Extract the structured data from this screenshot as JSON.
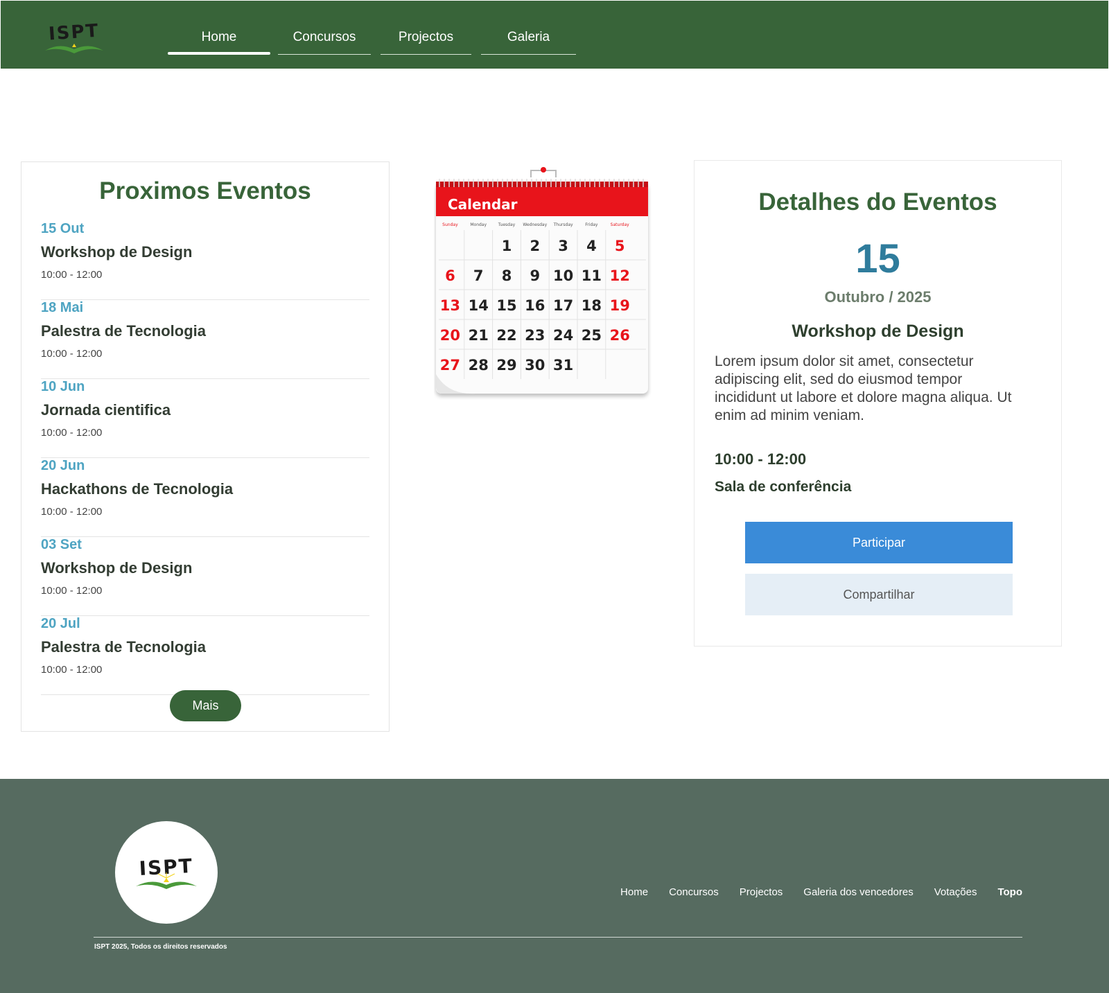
{
  "header": {
    "logo_text": "ISPT",
    "nav": [
      {
        "label": "Home",
        "active": true
      },
      {
        "label": "Concursos",
        "active": false
      },
      {
        "label": "Projectos",
        "active": false
      },
      {
        "label": "Galeria",
        "active": false
      }
    ]
  },
  "events": {
    "title": "Proximos Eventos",
    "items": [
      {
        "date": "15 Out",
        "title": "Workshop de Design",
        "time": "10:00 - 12:00"
      },
      {
        "date": "18 Mai",
        "title": "Palestra de Tecnologia",
        "time": "10:00 - 12:00"
      },
      {
        "date": "10 Jun",
        "title": "Jornada cientifica",
        "time": "10:00 - 12:00"
      },
      {
        "date": "20 Jun",
        "title": "Hackathons de Tecnologia",
        "time": "10:00 - 12:00"
      },
      {
        "date": "03 Set",
        "title": "Workshop de Design",
        "time": "10:00 - 12:00"
      },
      {
        "date": "20 Jul",
        "title": "Palestra de Tecnologia",
        "time": "10:00 - 12:00"
      }
    ],
    "more_label": "Mais"
  },
  "calendar_image": {
    "header": "Calendar",
    "weekdays": [
      "Sunday",
      "Monday",
      "Tuesday",
      "Wednesday",
      "Thursday",
      "Friday",
      "Saturday"
    ],
    "weeks": [
      [
        "",
        "",
        "1",
        "2",
        "3",
        "4",
        "5"
      ],
      [
        "6",
        "7",
        "8",
        "9",
        "10",
        "11",
        "12"
      ],
      [
        "13",
        "14",
        "15",
        "16",
        "17",
        "18",
        "19"
      ],
      [
        "20",
        "21",
        "22",
        "23",
        "24",
        "25",
        "26"
      ],
      [
        "27",
        "28",
        "29",
        "30",
        "31",
        "",
        ""
      ]
    ],
    "accent": "#e8141b"
  },
  "details": {
    "title": "Detalhes do Eventos",
    "day": "15",
    "month_year": "Outubro / 2025",
    "event_title": "Workshop de Design",
    "description": "Lorem ipsum dolor sit amet, consectetur adipiscing elit, sed do eiusmod tempor incididunt ut labore et dolore magna aliqua. Ut enim ad minim veniam.",
    "time": "10:00 - 12:00",
    "place": "Sala de conferência",
    "participate_label": "Participar",
    "share_label": "Compartilhar"
  },
  "footer": {
    "logo_text": "ISPT",
    "links": [
      {
        "label": "Home",
        "bold": false
      },
      {
        "label": "Concursos",
        "bold": false
      },
      {
        "label": "Projectos",
        "bold": false
      },
      {
        "label": "Galeria dos vencedores",
        "bold": false
      },
      {
        "label": "Votações",
        "bold": false
      },
      {
        "label": "Topo",
        "bold": true
      }
    ],
    "copyright": "ISPT 2025, Todos os direitos reservados"
  },
  "colors": {
    "brand_green": "#386439",
    "footer_bg": "#566b60",
    "date_blue": "#4ea4c2",
    "primary_button": "#3a8bd8"
  }
}
